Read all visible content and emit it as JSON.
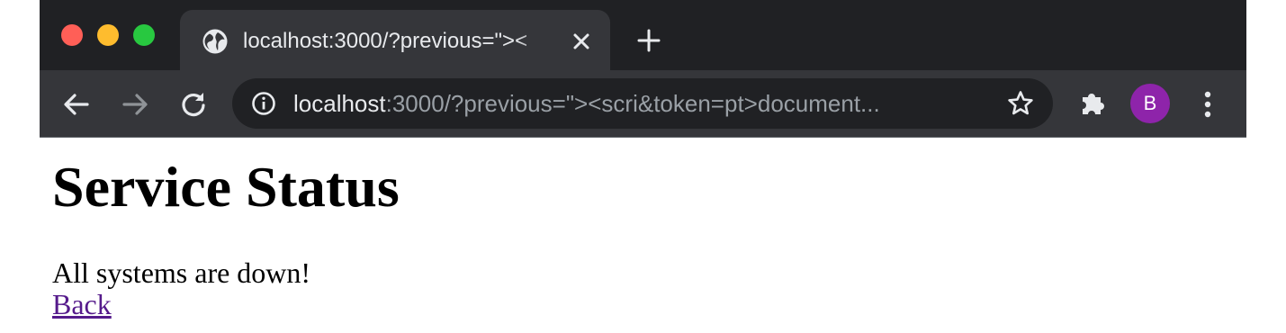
{
  "browser": {
    "window_controls": {
      "close_color": "#ff5f57",
      "minimize_color": "#febc2e",
      "maximize_color": "#28c840"
    },
    "tab": {
      "title": "localhost:3000/?previous=\"><",
      "favicon": "globe-icon",
      "close_icon": "close-icon"
    },
    "new_tab_icon": "plus-icon",
    "toolbar": {
      "back_icon": "arrow-left-icon",
      "forward_icon": "arrow-right-icon",
      "reload_icon": "reload-icon",
      "site_info_icon": "info-icon",
      "bookmark_icon": "star-icon",
      "extensions_icon": "puzzle-icon",
      "menu_icon": "more-vert-icon"
    },
    "address_bar": {
      "host": "localhost",
      "rest": ":3000/?previous=\"><scri&token=pt>document..."
    },
    "profile": {
      "initial": "B",
      "color": "#8e24aa"
    }
  },
  "page": {
    "title": "Service Status",
    "status_text": "All systems are down!",
    "back_link": "Back",
    "link_color": "#551a8b"
  }
}
